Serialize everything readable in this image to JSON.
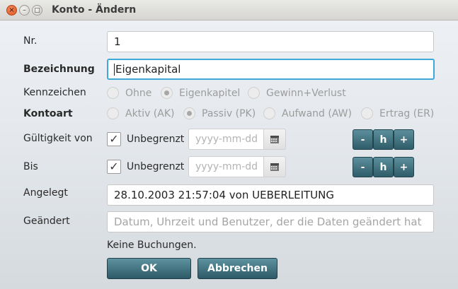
{
  "window": {
    "title": "Konto - Ändern",
    "close_glyph": "×",
    "min_glyph": "–",
    "max_glyph": "□"
  },
  "form": {
    "nr": {
      "label": "Nr.",
      "value": "1"
    },
    "bezeichnung": {
      "label": "Bezeichnung",
      "value": "Eigenkapital"
    },
    "kennzeichen": {
      "label": "Kennzeichen",
      "options": [
        "Ohne",
        "Eigenkapitel",
        "Gewinn+Verlust"
      ],
      "selected": "Eigenkapitel"
    },
    "kontoart": {
      "label": "Kontoart",
      "options": [
        "Aktiv (AK)",
        "Passiv (PK)",
        "Aufwand (AW)",
        "Ertrag (ER)"
      ],
      "selected": "Passiv (PK)"
    },
    "gueltig_von": {
      "label": "Gültigkeit von",
      "checkbox_label": "Unbegrenzt",
      "checked": true,
      "date_placeholder": "yyyy-mm-dd",
      "btn_minus": "-",
      "btn_h": "h",
      "btn_plus": "+"
    },
    "bis": {
      "label": "Bis",
      "checkbox_label": "Unbegrenzt",
      "checked": true,
      "date_placeholder": "yyyy-mm-dd",
      "btn_minus": "-",
      "btn_h": "h",
      "btn_plus": "+"
    },
    "angelegt": {
      "label": "Angelegt",
      "value": "28.10.2003 21:57:04 von UEBERLEITUNG"
    },
    "geaendert": {
      "label": "Geändert",
      "placeholder": "Datum, Uhrzeit und Benutzer, der die Daten geändert hat"
    },
    "info_text": "Keine Buchungen."
  },
  "buttons": {
    "ok": "OK",
    "cancel": "Abbrechen"
  },
  "icons": {
    "calendar": "calendar-icon",
    "check": "✓"
  },
  "colors": {
    "accent_focus": "#3ea8d8",
    "button_teal": "#3b6e7a",
    "close_orange": "#e0541f"
  }
}
